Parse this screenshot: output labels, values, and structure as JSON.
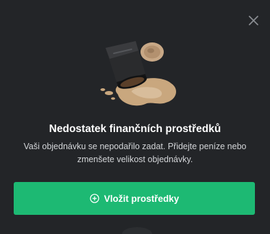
{
  "dialog": {
    "title": "Nedostatek finančních prostředků",
    "description": "Vaši objednávku se nepodařilo zadat. Přidejte peníze nebo zmenšete velikost objednávky.",
    "primary_button_label": "Vložit prostředky",
    "primary_button_icon": "plus-circle-icon",
    "close_icon": "close-icon",
    "illustration": "spilled-coffee-cup-illustration",
    "accent_color": "#1db973"
  }
}
